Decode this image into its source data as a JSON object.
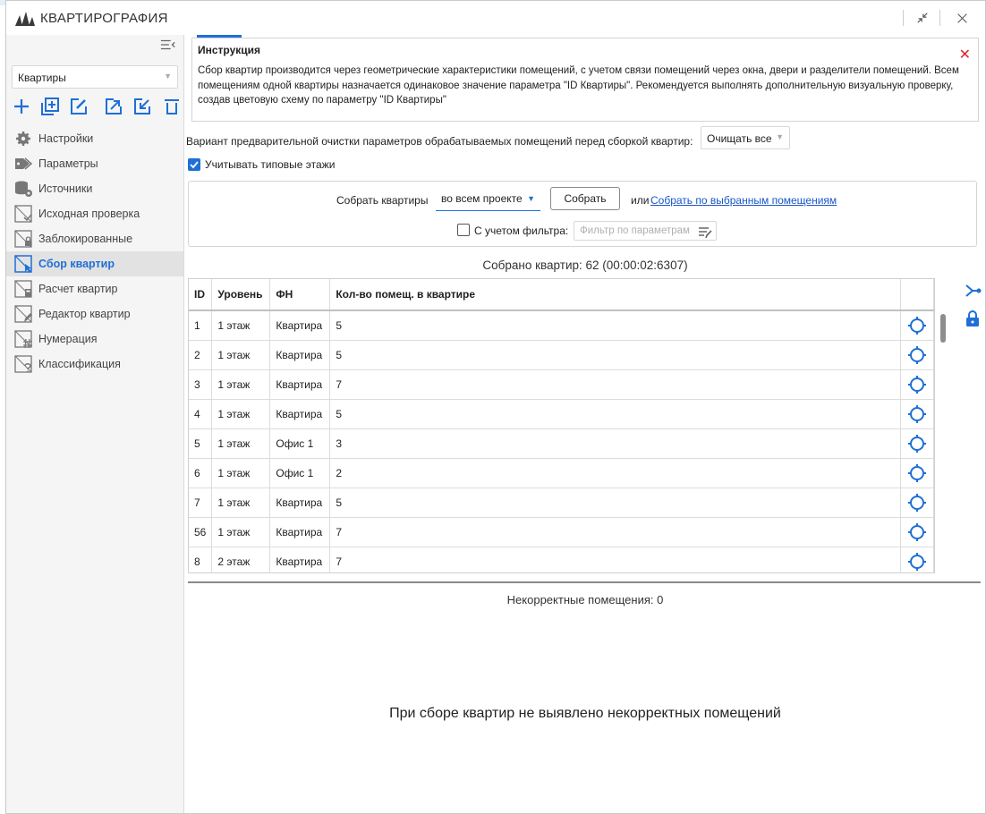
{
  "window": {
    "title": "КВАРТИРОГРАФИЯ",
    "minimize_icon": "collapse-arrows-icon",
    "close_icon": "close-icon"
  },
  "sidebar": {
    "combo_value": "Квартиры",
    "toolbar_icons": [
      "plus-icon",
      "add-square-icon",
      "edit-icon",
      "export-icon",
      "import-icon",
      "trash-icon"
    ],
    "items": [
      {
        "label": "Настройки",
        "icon": "gear-icon",
        "active": false
      },
      {
        "label": "Параметры",
        "icon": "tags-icon",
        "active": false
      },
      {
        "label": "Источники",
        "icon": "database-icon",
        "active": false
      },
      {
        "label": "Исходная проверка",
        "icon": "check-sheet-icon",
        "active": false
      },
      {
        "label": "Заблокированные",
        "icon": "lock-sheet-icon",
        "active": false
      },
      {
        "label": "Сбор квартир",
        "icon": "cursor-sheet-icon",
        "active": true
      },
      {
        "label": "Расчет квартир",
        "icon": "calc-sheet-icon",
        "active": false
      },
      {
        "label": "Редактор квартир",
        "icon": "edit-sheet-icon",
        "active": false
      },
      {
        "label": "Нумерация",
        "icon": "hash-sheet-icon",
        "active": false
      },
      {
        "label": "Классификация",
        "icon": "classify-sheet-icon",
        "active": false
      }
    ]
  },
  "instruction": {
    "title": "Инструкция",
    "text": "Сбор квартир производится через геометрические характеристики помещений, с учетом связи помещений через окна, двери и разделители помещений. Всем помещениям одной квартиры назначается одинаковое значение параметра \"ID Квартиры\". Рекомендуется выполнять дополнительную визуальную проверку, создав цветовую схему по параметру \"ID Квартиры\""
  },
  "precleaning": {
    "label": "Вариант предварительной очистки параметров обрабатываемых помещений перед сборкой квартир:",
    "value": "Очищать все"
  },
  "typical_floors": {
    "label": "Учитывать типовые этажи",
    "checked": true
  },
  "collect": {
    "label": "Собрать квартиры",
    "scope": "во всем проекте",
    "button": "Собрать",
    "or": "или",
    "link": "Собрать по выбранным помещениям",
    "filter_check_label": "С учетом фильтра:",
    "filter_checked": false,
    "filter_placeholder": "Фильтр по параметрам"
  },
  "collected_status": "Собрано квартир: 62 (00:00:02:6307)",
  "table": {
    "headers": [
      "ID",
      "Уровень",
      "ФН",
      "Кол-во помещ. в квартире"
    ],
    "rows": [
      [
        "1",
        "1 этаж",
        "Квартира",
        "5"
      ],
      [
        "2",
        "1 этаж",
        "Квартира",
        "5"
      ],
      [
        "3",
        "1 этаж",
        "Квартира",
        "7"
      ],
      [
        "4",
        "1 этаж",
        "Квартира",
        "5"
      ],
      [
        "5",
        "1 этаж",
        "Офис 1",
        "3"
      ],
      [
        "6",
        "1 этаж",
        "Офис 1",
        "2"
      ],
      [
        "7",
        "1 этаж",
        "Квартира",
        "5"
      ],
      [
        "56",
        "1 этаж",
        "Квартира",
        "7"
      ],
      [
        "8",
        "2 этаж",
        "Квартира",
        "7"
      ]
    ]
  },
  "incorrect_status": "Некорректные помещения: 0",
  "no_errors_message": "При сборе квартир не выявлено некорректных помещений",
  "colors": {
    "accent": "#1f6fd6",
    "close_red": "#d9262c"
  }
}
